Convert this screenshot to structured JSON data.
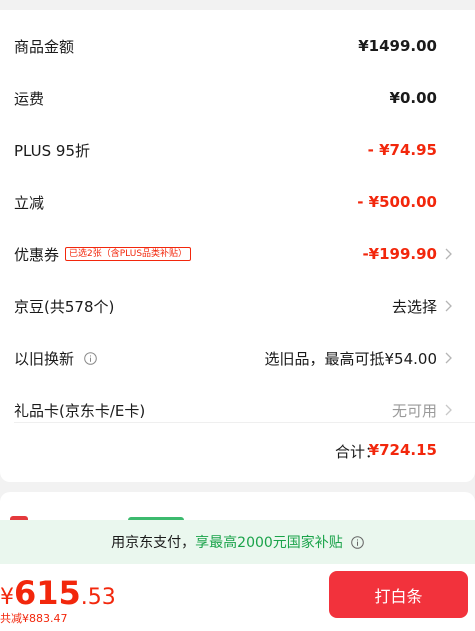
{
  "rows": [
    {
      "label": "商品金额",
      "value": "¥1499.00"
    },
    {
      "label": "运费",
      "value": "¥0.00"
    },
    {
      "label": "PLUS 95折",
      "value": "- ¥74.95"
    },
    {
      "label": "立减",
      "value": "- ¥500.00"
    },
    {
      "label": "优惠券",
      "tag": "已选2张（含PLUS品类补贴）",
      "value": "-¥199.90"
    },
    {
      "label": "京豆(共578个)",
      "value": "去选择"
    },
    {
      "label": "以旧换新",
      "value": "选旧品，最高可抵¥54.00"
    },
    {
      "label": "礼品卡(京东卡/E卡)",
      "value": "无可用"
    }
  ],
  "total": {
    "label": "合计：",
    "value": "¥724.15"
  },
  "promo": {
    "text1": "用京东支付，",
    "text2": "享最高2000元国家补贴"
  },
  "footer": {
    "price_symbol": "¥",
    "price_int": "615",
    "price_dec": ".53",
    "discount": "共减¥883.47",
    "pay_button": "打白条"
  },
  "colors": {
    "accent": "#f2270c",
    "button": "#f2323c",
    "promo_bg": "#eaf7ee",
    "promo_green": "#1aa34a"
  },
  "icons": {
    "arrow": "chevron-right-icon",
    "info": "info-circle-icon"
  }
}
